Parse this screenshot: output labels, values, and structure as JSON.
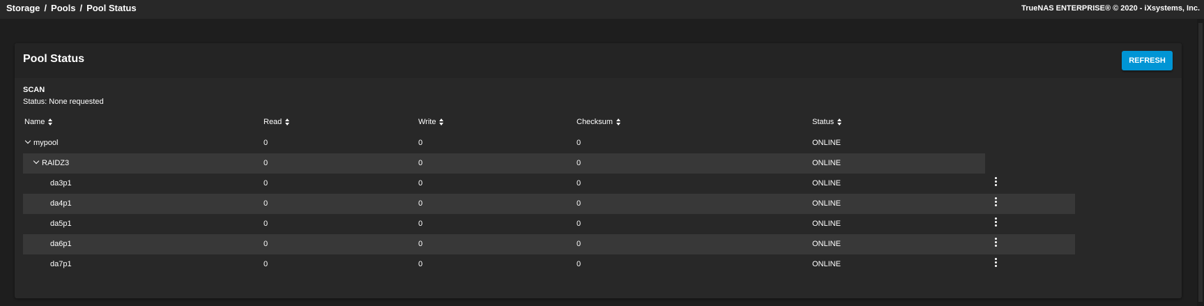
{
  "breadcrumb": {
    "items": [
      "Storage",
      "Pools",
      "Pool Status"
    ],
    "separator": "/"
  },
  "copyright": "TrueNAS ENTERPRISE® © 2020 - iXsystems, Inc.",
  "card": {
    "title": "Pool Status",
    "refresh_label": "REFRESH"
  },
  "scan": {
    "title": "SCAN",
    "status": "Status: None requested"
  },
  "table": {
    "columns": [
      "Name",
      "Read",
      "Write",
      "Checksum",
      "Status"
    ],
    "rows": [
      {
        "name": "mypool",
        "read": "0",
        "write": "0",
        "checksum": "0",
        "status": "ONLINE"
      },
      {
        "name": "RAIDZ3",
        "read": "0",
        "write": "0",
        "checksum": "0",
        "status": "ONLINE"
      },
      {
        "name": "da3p1",
        "read": "0",
        "write": "0",
        "checksum": "0",
        "status": "ONLINE"
      },
      {
        "name": "da4p1",
        "read": "0",
        "write": "0",
        "checksum": "0",
        "status": "ONLINE"
      },
      {
        "name": "da5p1",
        "read": "0",
        "write": "0",
        "checksum": "0",
        "status": "ONLINE"
      },
      {
        "name": "da6p1",
        "read": "0",
        "write": "0",
        "checksum": "0",
        "status": "ONLINE"
      },
      {
        "name": "da7p1",
        "read": "0",
        "write": "0",
        "checksum": "0",
        "status": "ONLINE"
      }
    ]
  },
  "colors": {
    "accent": "#0095d5",
    "background": "#1e1e1e",
    "card": "#282828",
    "stripe": "#383838"
  },
  "icons": {
    "sort": "sort-icon",
    "expand": "chevron-down-icon",
    "row_menu": "more-vert-icon"
  }
}
